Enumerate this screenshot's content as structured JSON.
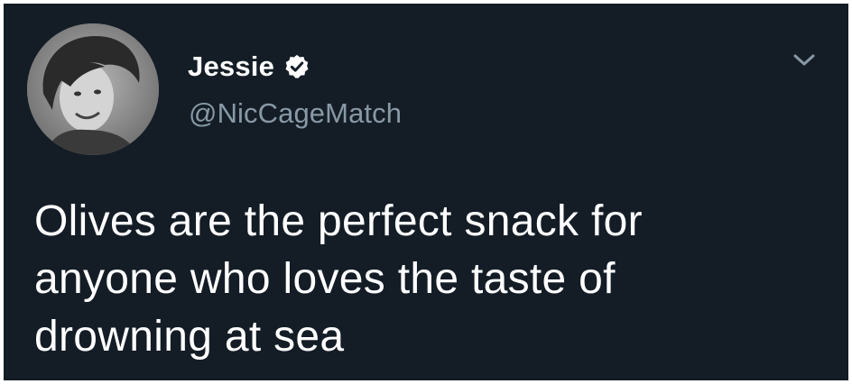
{
  "tweet": {
    "author": {
      "display_name": "Jessie",
      "handle": "@NicCageMatch",
      "verified": true,
      "avatar_icon": "profile-photo-avatar",
      "verified_icon": "verified-badge-icon"
    },
    "menu_icon": "chevron-down-icon",
    "text_lines": [
      "Olives are the perfect snack for",
      "anyone who loves the taste of",
      "drowning at sea"
    ]
  },
  "colors": {
    "background": "#141d26",
    "primary_text": "#ffffff",
    "secondary_text": "#8899a6",
    "chevron": "#8899a6"
  }
}
